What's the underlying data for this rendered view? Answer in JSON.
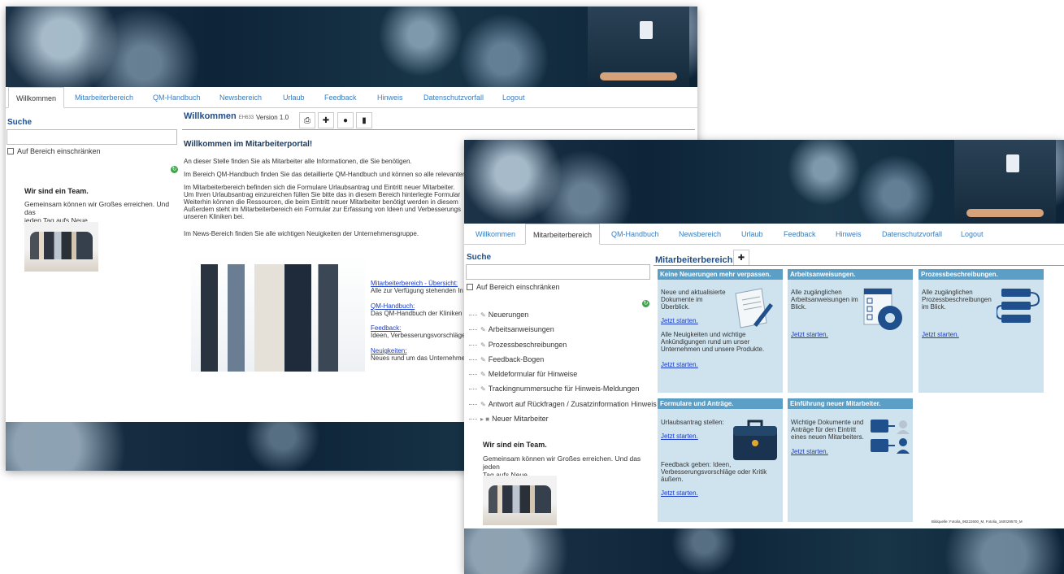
{
  "w1": {
    "nav": [
      "Willkommen",
      "Mitarbeiterbereich",
      "QM-Handbuch",
      "Newsbereich",
      "Urlaub",
      "Feedback",
      "Hinweis",
      "Datenschutzvorfall",
      "Logout"
    ],
    "search_label": "Suche",
    "restrict_label": "Auf Bereich einschränken",
    "team_heading": "Wir sind ein Team.",
    "team_text_1": "Gemeinsam können wir Großes erreichen. Und das",
    "team_text_2": "jeden Tag aufs Neue.",
    "page_title": "Willkommen",
    "page_code": "EH633",
    "version": "Version 1.0",
    "welcome_heading": "Willkommen im Mitarbeiterportal!",
    "p1": "An dieser Stelle finden Sie als Mitarbeiter alle Informationen, die Sie benötigen.",
    "p2": "Im Bereich QM-Handbuch finden Sie das detaillierte QM-Handbuch und können so alle relevanten",
    "p3a": "Im Mitarbeiterbereich befinden sich die Formulare Urlaubsantrag und Eintritt neuer Mitarbeiter.",
    "p3b": "Um Ihren Urlaubsantrag einzureichen füllen Sie bitte das in diesem Bereich hinterlegte Formular",
    "p3c": "Weiterhin können die Ressourcen, die beim Eintritt neuer Mitarbeiter benötigt werden in diesem",
    "p3d": "Außerdem steht im Mitarbeiterbereich ein Formular zur Erfassung von Ideen und Verbesserungs",
    "p3e": "unseren Kliniken bei.",
    "p4": "Im News-Bereich finden Sie alle wichtigen Neuigkeiten der Unternehmensgruppe.",
    "links": [
      {
        "link": "Mitarbeiterbereich - Übersicht:",
        "text": "Alle zur Verfügung stehenden In"
      },
      {
        "link": "QM-Handbuch:",
        "text": "Das QM-Handbuch der Kliniken"
      },
      {
        "link": "Feedback:",
        "text": "Ideen, Verbesserungsvorschläge"
      },
      {
        "link": "Neuigkeiten:",
        "text": "Neues rund um das Unternehme"
      }
    ]
  },
  "w2": {
    "nav": [
      "Willkommen",
      "Mitarbeiterbereich",
      "QM-Handbuch",
      "Newsbereich",
      "Urlaub",
      "Feedback",
      "Hinweis",
      "Datenschutzvorfall",
      "Logout"
    ],
    "search_label": "Suche",
    "restrict_label": "Auf Bereich einschränken",
    "tree": [
      "Neuerungen",
      "Arbeitsanweisungen",
      "Prozessbeschreibungen",
      "Feedback-Bogen",
      "Meldeformular für Hinweise",
      "Trackingnummersuche für Hinweis-Meldungen",
      "Antwort auf Rückfragen / Zusatzinformation Hinweis",
      "Neuer Mitarbeiter"
    ],
    "team_heading": "Wir sind ein Team.",
    "team_text_1": "Gemeinsam können wir Großes erreichen. Und das jeden",
    "team_text_2": "Tag aufs Neue.",
    "page_title": "Mitarbeiterbereich",
    "tiles": {
      "t1": {
        "head": "Keine Neuerungen mehr verpassen.",
        "a1": "Neue und aktualisierte",
        "a2": "Dokumente im",
        "a3": "Überblick.",
        "link1": "Jetzt starten.",
        "b1": "Alle Neuigkeiten und wichtige",
        "b2": "Ankündigungen rund um unser",
        "b3": "Unternehmen und unsere Produkte.",
        "link2": "Jetzt starten."
      },
      "t2": {
        "head": "Arbeitsanweisungen.",
        "a1": "Alle zugänglichen",
        "a2": "Arbeitsanweisungen im",
        "a3": "Blick.",
        "link1": "Jetzt starten."
      },
      "t3": {
        "head": "Prozessbeschreibungen.",
        "a1": "Alle zugänglichen",
        "a2": "Prozessbeschreibungen",
        "a3": "im Blick.",
        "link1": "Jetzt starten."
      },
      "t4": {
        "head": "Formulare und Anträge.",
        "a1": "Urlaubsantrag stellen:",
        "link1": "Jetzt starten.",
        "b1": "Feedback geben: Ideen,",
        "b2": "Verbesserungsvorschläge oder Kritik",
        "b3": "äußern.",
        "link2": "Jetzt starten."
      },
      "t5": {
        "head": "Einführung neuer Mitarbeiter.",
        "a1": "Wichtige Dokumente und",
        "a2": "Anträge für den Eintritt",
        "a3": "eines neuen Mitarbeiters.",
        "link1": "Jetzt starten."
      }
    },
    "credit": "Bildquelle: Fotolia_98222600_M, Fotolia_160029570_M"
  },
  "colors": {
    "link": "#1a3cc8",
    "tab": "#3a7dbf",
    "tile_head": "#5b9fc7",
    "tile_bg": "#cfe3ee",
    "title": "#1f4f8c"
  }
}
